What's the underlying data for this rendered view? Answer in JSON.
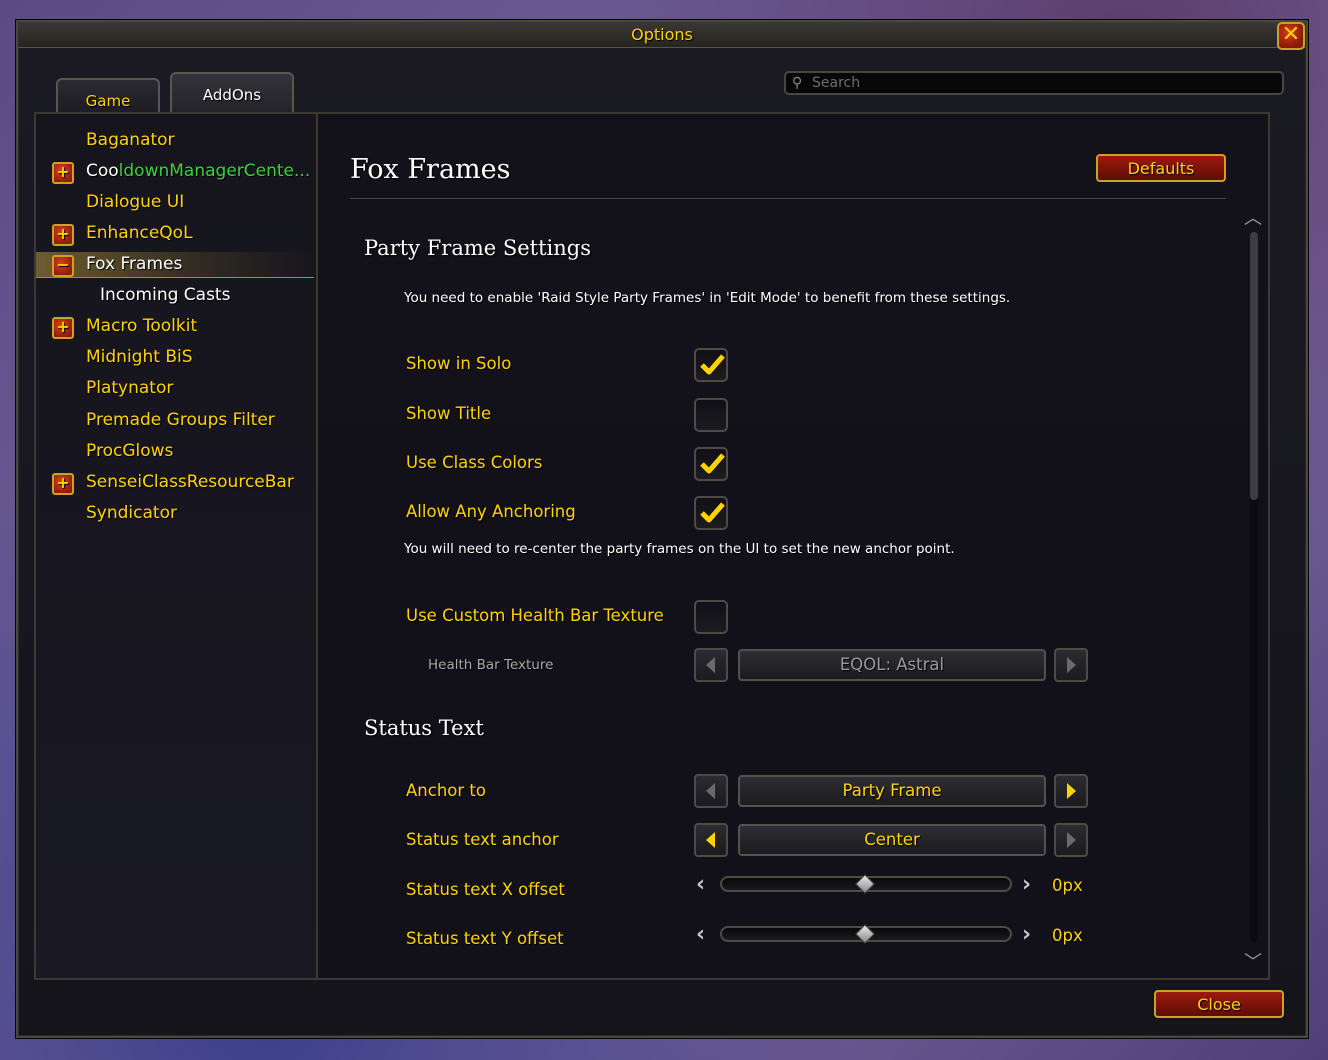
{
  "window": {
    "title": "Options"
  },
  "tabs": [
    {
      "label": "Game"
    },
    {
      "label": "AddOns"
    }
  ],
  "search": {
    "placeholder": "Search"
  },
  "sidebar": {
    "items": [
      {
        "label": "Baganator",
        "expander": ""
      },
      {
        "label_part1": "Coo",
        "label_part2": "ldownManagerCente...",
        "expander": "+"
      },
      {
        "label": "Dialogue UI",
        "expander": ""
      },
      {
        "label": "EnhanceQoL",
        "expander": "+"
      },
      {
        "label": "Fox Frames",
        "expander": "−",
        "selected": true
      },
      {
        "label": "Incoming Casts",
        "expander": ""
      },
      {
        "label": "Macro Toolkit",
        "expander": "+"
      },
      {
        "label": "Midnight BiS",
        "expander": ""
      },
      {
        "label": "Platynator",
        "expander": ""
      },
      {
        "label": "Premade Groups Filter",
        "expander": ""
      },
      {
        "label": "ProcGlows",
        "expander": ""
      },
      {
        "label": "SenseiClassResourceBar",
        "expander": "+"
      },
      {
        "label": "Syndicator",
        "expander": ""
      }
    ]
  },
  "content": {
    "title": "Fox Frames",
    "defaults_label": "Defaults",
    "party_section": {
      "title": "Party Frame Settings",
      "note": "You need to enable 'Raid Style Party Frames' in 'Edit Mode' to benefit from these settings.",
      "options": [
        {
          "label": "Show in Solo",
          "checked": true
        },
        {
          "label": "Show Title",
          "checked": false
        },
        {
          "label": "Use Class Colors",
          "checked": true
        },
        {
          "label": "Allow Any Anchoring",
          "checked": true
        }
      ],
      "anchor_note": "You will need to re-center the party frames on the UI to set the new anchor point.",
      "custom_texture": {
        "label": "Use Custom Health Bar Texture",
        "checked": false
      },
      "texture_select": {
        "label": "Health Bar Texture",
        "value": "EQOL: Astral"
      }
    },
    "status_section": {
      "title": "Status Text",
      "anchor_to": {
        "label": "Anchor to",
        "value": "Party Frame"
      },
      "status_anchor": {
        "label": "Status text anchor",
        "value": "Center"
      },
      "x_offset": {
        "label": "Status text X offset",
        "value": "0px",
        "fraction": 0.5
      },
      "y_offset": {
        "label": "Status text Y offset",
        "value": "0px",
        "fraction": 0.5
      }
    }
  },
  "footer": {
    "close_label": "Close"
  },
  "colors": {
    "gold": "#ffd200",
    "accent_red": "#9c1a0c",
    "addon_green": "#3bd13b"
  }
}
